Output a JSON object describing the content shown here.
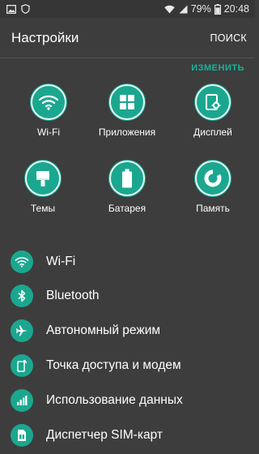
{
  "status_bar": {
    "left_icons": [
      "image-icon",
      "shield-icon"
    ],
    "right_icons": [
      "wifi-icon",
      "signal-icon",
      "battery-icon"
    ],
    "battery": "79%",
    "time": "20:48"
  },
  "header": {
    "title": "Настройки",
    "search_label": "ПОИСК"
  },
  "quick": {
    "edit_label": "ИЗМЕНИТЬ",
    "tiles": [
      {
        "label": "Wi-Fi",
        "icon": "wifi-icon"
      },
      {
        "label": "Приложения",
        "icon": "apps-icon"
      },
      {
        "label": "Дисплей",
        "icon": "display-icon"
      },
      {
        "label": "Темы",
        "icon": "brush-icon"
      },
      {
        "label": "Батарея",
        "icon": "battery-icon"
      },
      {
        "label": "Память",
        "icon": "memory-icon"
      }
    ]
  },
  "list": {
    "items": [
      {
        "label": "Wi-Fi",
        "icon": "wifi-icon"
      },
      {
        "label": "Bluetooth",
        "icon": "bluetooth-icon"
      },
      {
        "label": "Автономный режим",
        "icon": "airplane-icon"
      },
      {
        "label": "Точка доступа и модем",
        "icon": "hotspot-icon"
      },
      {
        "label": "Использование данных",
        "icon": "data-usage-icon"
      },
      {
        "label": "Диспетчер SIM-карт",
        "icon": "sim-icon"
      }
    ]
  },
  "colors": {
    "accent": "#1ba78f",
    "background": "#3d3d3d",
    "status_bar": "#363636",
    "edit_link": "#19b39a"
  }
}
